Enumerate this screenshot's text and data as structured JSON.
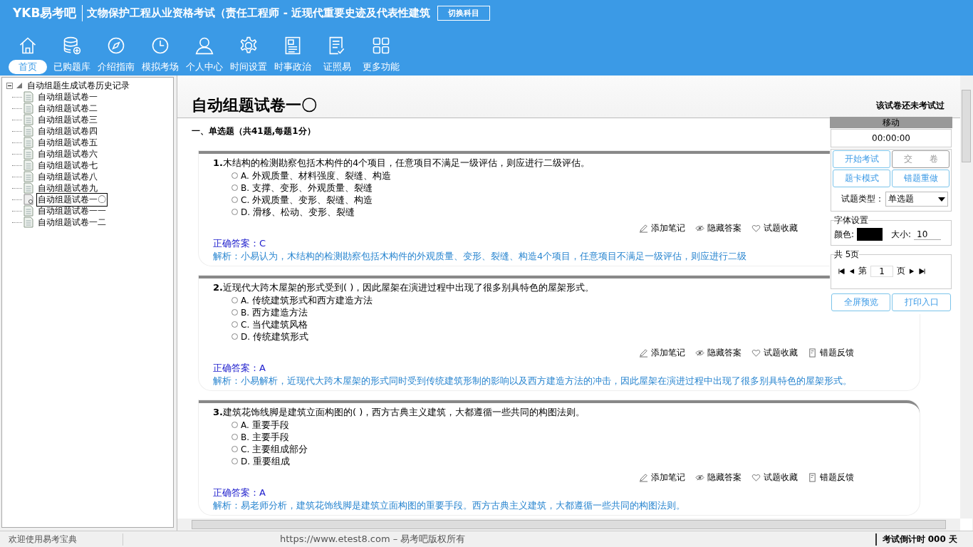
{
  "header": {
    "logo": "YKB易考吧",
    "title": "文物保护工程从业资格考试（责任工程师 - 近现代重要史迹及代表性建筑",
    "switch_button": "切换科目"
  },
  "nav": [
    {
      "label": "首页",
      "kind": "home",
      "selected": true
    },
    {
      "label": "已购题库",
      "kind": "database",
      "selected": false
    },
    {
      "label": "介绍指南",
      "kind": "compass",
      "selected": false
    },
    {
      "label": "模拟考场",
      "kind": "clock",
      "selected": false
    },
    {
      "label": "个人中心",
      "kind": "person",
      "selected": false
    },
    {
      "label": "时间设置",
      "kind": "gear",
      "selected": false
    },
    {
      "label": "时事政治",
      "kind": "news",
      "selected": false
    },
    {
      "label": "证照易",
      "kind": "checklist",
      "selected": false
    },
    {
      "label": "更多功能",
      "kind": "grid",
      "selected": false
    }
  ],
  "tree": {
    "label": "自动组题生成试卷历史记录",
    "expanded": true,
    "children": [
      {
        "label": "自动组题试卷一",
        "selected": false
      },
      {
        "label": "自动组题试卷二",
        "selected": false
      },
      {
        "label": "自动组题试卷三",
        "selected": false
      },
      {
        "label": "自动组题试卷四",
        "selected": false
      },
      {
        "label": "自动组题试卷五",
        "selected": false
      },
      {
        "label": "自动组题试卷六",
        "selected": false
      },
      {
        "label": "自动组题试卷七",
        "selected": false
      },
      {
        "label": "自动组题试卷八",
        "selected": false
      },
      {
        "label": "自动组题试卷九",
        "selected": false
      },
      {
        "label": "自动组题试卷一〇",
        "selected": true
      },
      {
        "label": "自动组题试卷一一",
        "selected": false
      },
      {
        "label": "自动组题试卷一二",
        "selected": false
      }
    ]
  },
  "paper": {
    "title": "自动组题试卷一〇",
    "status": "该试卷还未考试过",
    "section": "一、单选题（共41题,每题1分）",
    "questions": [
      {
        "number": "1.",
        "text": "木结构的检测勘察包括木构件的4个项目，任意项目不满足一级评估，则应进行二级评估。",
        "options": [
          {
            "letter": "A.",
            "text": "外观质量、材料强度、裂缝、构造",
            "selected": false
          },
          {
            "letter": "B.",
            "text": "支撑、变形、外观质量、裂缝",
            "selected": false
          },
          {
            "letter": "C.",
            "text": "外观质量、变形、裂缝、构造",
            "selected": false
          },
          {
            "letter": "D.",
            "text": "滑移、松动、变形、裂缝",
            "selected": false
          }
        ],
        "actions": [
          {
            "kind": "note",
            "label": "添加笔记"
          },
          {
            "kind": "hide",
            "label": "隐藏答案"
          },
          {
            "kind": "favorite",
            "label": "试题收藏"
          }
        ],
        "answer_label": "正确答案：",
        "answer": "C",
        "analysis": "解析：小易认为，木结构的检测勘察包括木构件的外观质量、变形、裂缝、构造4个项目，任意项目不满足一级评估，则应进行二级"
      },
      {
        "number": "2.",
        "text": "近现代大跨木屋架的形式受到( )，因此屋架在演进过程中出现了很多别具特色的屋架形式。",
        "options": [
          {
            "letter": "A.",
            "text": "传统建筑形式和西方建造方法",
            "selected": false
          },
          {
            "letter": "B.",
            "text": "西方建造方法",
            "selected": false
          },
          {
            "letter": "C.",
            "text": "当代建筑风格",
            "selected": false
          },
          {
            "letter": "D.",
            "text": "传统建筑形式",
            "selected": false
          }
        ],
        "actions": [
          {
            "kind": "note",
            "label": "添加笔记"
          },
          {
            "kind": "hide",
            "label": "隐藏答案"
          },
          {
            "kind": "favorite",
            "label": "试题收藏"
          },
          {
            "kind": "report",
            "label": "错题反馈"
          }
        ],
        "answer_label": "正确答案：",
        "answer": "A",
        "analysis": "解析：小易解析，近现代大跨木屋架的形式同时受到传统建筑形制的影响以及西方建造方法的冲击，因此屋架在演进过程中出现了很多别具特色的屋架形式。"
      },
      {
        "number": "3.",
        "text": "建筑花饰线脚是建筑立面构图的( )，西方古典主义建筑，大都遵循一些共同的构图法则。",
        "options": [
          {
            "letter": "A.",
            "text": "重要手段",
            "selected": false
          },
          {
            "letter": "B.",
            "text": "主要手段",
            "selected": false
          },
          {
            "letter": "C.",
            "text": "主要组成部分",
            "selected": false
          },
          {
            "letter": "D.",
            "text": "重要组成",
            "selected": false
          }
        ],
        "actions": [
          {
            "kind": "note",
            "label": "添加笔记"
          },
          {
            "kind": "hide",
            "label": "隐藏答案"
          },
          {
            "kind": "favorite",
            "label": "试题收藏"
          },
          {
            "kind": "report",
            "label": "错题反馈"
          }
        ],
        "answer_label": "正确答案：",
        "answer": "A",
        "analysis": "解析：易老师分析，建筑花饰线脚是建筑立面构图的重要手段。西方古典主义建筑，大都遵循一些共同的构图法则。"
      }
    ]
  },
  "panel": {
    "title": "移动",
    "timer": "00:00:00",
    "buttons": [
      {
        "label": "开始考试",
        "disabled": false
      },
      {
        "label": "交　　卷",
        "disabled": true
      },
      {
        "label": "题卡模式",
        "disabled": false
      },
      {
        "label": "错题重做",
        "disabled": false
      }
    ],
    "type_label": "试题类型：",
    "type_value": "单选题",
    "font_group": "字体设置",
    "color_label": "颜色:",
    "size_label": "大小:",
    "size_value": "10",
    "pages_group": "共 5页",
    "page_prefix": "第",
    "page_value": "1",
    "page_suffix": "页",
    "bottom_buttons": [
      "全屏预览",
      "打印入口"
    ]
  },
  "status_bar": {
    "left": "欢迎使用易考宝典",
    "center": "https://www.etest8.com – 易考吧版权所有",
    "right": "考试倒计时 000 天"
  }
}
